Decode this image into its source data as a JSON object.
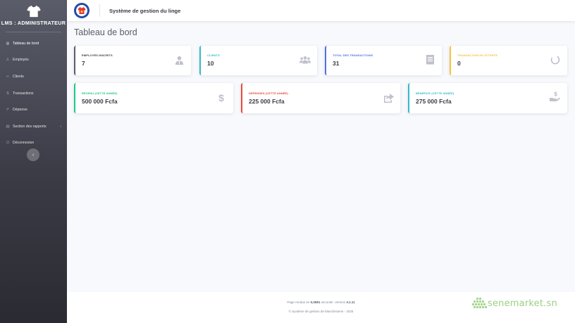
{
  "sidebar": {
    "brand": "LMS : ADMINISTRATEUR",
    "items": [
      {
        "label": "Tableau de bord",
        "icon": "palette-icon",
        "glyph": "◍"
      },
      {
        "label": "Employés",
        "icon": "user-icon",
        "glyph": "♙"
      },
      {
        "label": "Clients",
        "icon": "users-icon",
        "glyph": "∞"
      },
      {
        "label": "Transactions",
        "icon": "dollar-icon",
        "glyph": "$"
      },
      {
        "label": "Dépense",
        "icon": "share-icon",
        "glyph": "↱"
      },
      {
        "label": "Section des rapports",
        "icon": "file-icon",
        "glyph": "▤",
        "caret": "›"
      },
      {
        "label": "Déconnexion",
        "icon": "power-icon",
        "glyph": "⏻"
      }
    ],
    "toggle": "‹"
  },
  "topbar": {
    "title": "Système de gestion du linge"
  },
  "page": {
    "title": "Tableau de bord"
  },
  "stats_row1": [
    {
      "label": "EMPLOYÉS INSCRITS",
      "value": "7",
      "accent": "#5a5c69",
      "icon": "user-tie-icon"
    },
    {
      "label": "CLIENTS",
      "value": "10",
      "accent": "#36b9cc",
      "icon": "users-icon"
    },
    {
      "label": "TOTAL DES TRANSACTIONS",
      "value": "31",
      "accent": "#4e73df",
      "icon": "receipt-icon"
    },
    {
      "label": "TRANSACTION EN ATTENTE",
      "value": "0",
      "accent": "#f6c23e",
      "icon": "spinner-icon"
    }
  ],
  "stats_row2": [
    {
      "label": "REVENU (CETTE ANNÉE)",
      "value": "500 000 Fcfa",
      "accent": "#1cc88a",
      "icon": "dollar-icon"
    },
    {
      "label": "DÉPENSES (CETTE ANNÉE)",
      "value": "225 000 Fcfa",
      "accent": "#e74a3b",
      "icon": "share-square-icon"
    },
    {
      "label": "BÉNÉFICE (CETTE ANNÉE)",
      "value": "275 000 Fcfa",
      "accent": "#36b9cc",
      "icon": "hand-holding-dollar-icon"
    }
  ],
  "footer": {
    "render_prefix": "Page rendue en ",
    "render_time": "0,0681",
    "render_mid": " seconde. Version ",
    "version": "3.1.11",
    "copyright": "© Système de gestion de blanchisserie - 2025"
  },
  "watermark": {
    "text": "senemarket.sn"
  }
}
